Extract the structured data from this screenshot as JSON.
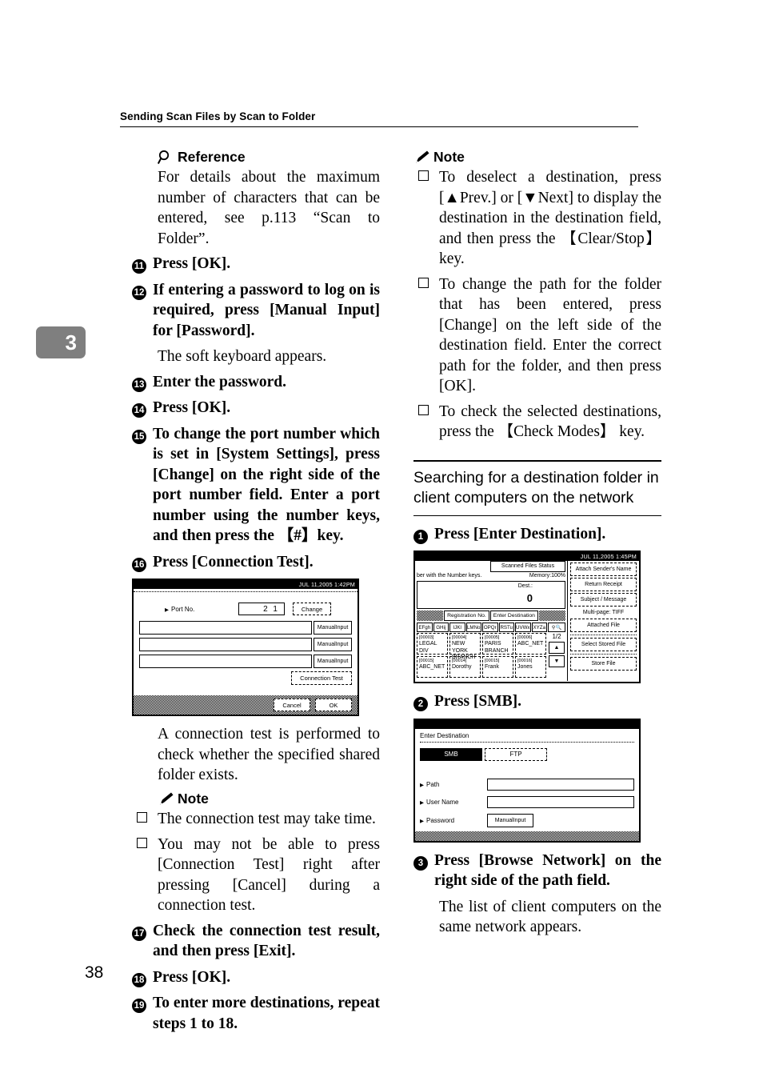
{
  "header": {
    "title": "Sending Scan Files by Scan to Folder"
  },
  "chapter": {
    "number": "3"
  },
  "page_number": "38",
  "left_column": {
    "reference": {
      "heading": "Reference",
      "body": "For details about the maximum number of characters that can be entered, see p.113 “Scan to Folder”."
    },
    "steps": [
      {
        "num": "11",
        "text": "Press [OK]."
      },
      {
        "num": "12",
        "text": "If entering a password to log on is required, press [Manual Input] for [Password]."
      },
      {
        "num": "13",
        "text": "Enter the password."
      },
      {
        "num": "14",
        "text": "Press [OK]."
      },
      {
        "num": "15",
        "text": "To change the port number which is set in [System Settings], press [Change] on the right side of the port number field. Enter a port number using the number keys, and then press the 【#】key."
      },
      {
        "num": "16",
        "text": "Press [Connection Test]."
      },
      {
        "num": "17",
        "text": "Check the connection test result, and then press [Exit]."
      },
      {
        "num": "18",
        "text": "Press [OK]."
      },
      {
        "num": "19",
        "text": "To enter more destinations, repeat steps 1 to 18."
      }
    ],
    "step12_result": "The soft keyboard appears.",
    "after_image_text": "A connection test is performed to check whether the specified shared folder exists.",
    "note": {
      "heading": "Note",
      "items": [
        "The connection test may take time.",
        "You may not be able to press [Connection Test] right after pressing [Cancel] during a connection test."
      ]
    }
  },
  "right_column": {
    "note": {
      "heading": "Note",
      "items": [
        "To deselect a destination, press [▲Prev.] or [▼Next] to display the destination in the destination field, and then press the 【Clear/Stop】 key.",
        "To change the path for the folder that has been entered, press [Change] on the left side of the destination field. Enter the correct path for the folder, and then press [OK].",
        "To check the selected destinations, press the 【Check Modes】 key."
      ]
    },
    "section": {
      "title": "Searching for a destination folder in client computers on the network"
    },
    "steps": [
      {
        "num": "1",
        "text": "Press [Enter Destination]."
      },
      {
        "num": "2",
        "text": "Press [SMB]."
      },
      {
        "num": "3",
        "text": "Press [Browse Network] on the right side of the path field."
      }
    ],
    "step3_result": "The list of client computers on the same network appears."
  },
  "lcd_port": {
    "timestamp": "JUL 11,2005 1:42PM",
    "port_label": "Port No.",
    "port_value": "2 1",
    "change_label": "Change",
    "manual_input_label": "ManualInput",
    "connection_test_label": "Connection Test",
    "cancel_label": "Cancel",
    "ok_label": "OK"
  },
  "lcd_main": {
    "timestamp": "JUL 11,2005 1:45PM",
    "scanned_files_status": "Scanned Files Status",
    "hint": "ber with the Number keys.",
    "memory": "Memory:100%",
    "dest_label": "Dest.:",
    "dest_value": "0",
    "registration_no": "Registration No.",
    "enter_destination": "Enter Destination",
    "alpha_tabs": [
      "EFgh",
      "GHij",
      "IJKl",
      "LMNo",
      "OPQr",
      "RSTu",
      "UVWx",
      "XYZa"
    ],
    "page_indicator": "1/2",
    "destinations": [
      {
        "id": "[00003]",
        "name": "LEGAL DIV"
      },
      {
        "id": "[00004]",
        "name": "NEW YORK BRANCH"
      },
      {
        "id": "[00005]",
        "name": "PARIS BRANCH"
      },
      {
        "id": "[00006]",
        "name": "ABC_NET"
      },
      {
        "id": "[00015]",
        "name": "ABC_NET"
      },
      {
        "id": "[00014]",
        "name": "Dorothy"
      },
      {
        "id": "[00015]",
        "name": "Frank"
      },
      {
        "id": "[00016]",
        "name": "Jones"
      }
    ],
    "right_buttons": [
      "Attach Sender's Name",
      "Return Receipt",
      "Subject / Message"
    ],
    "multipage_label": "Multi-page: TIFF",
    "attached_file": "Attached File",
    "select_stored_file": "Select Stored File",
    "store_file": "Store File"
  },
  "lcd_dest": {
    "title": "Enter Destination",
    "tab_smb": "SMB",
    "tab_ftp": "FTP",
    "path_label": "Path",
    "user_label": "User Name",
    "password_label": "Password",
    "manual_input_label": "ManualInput"
  }
}
